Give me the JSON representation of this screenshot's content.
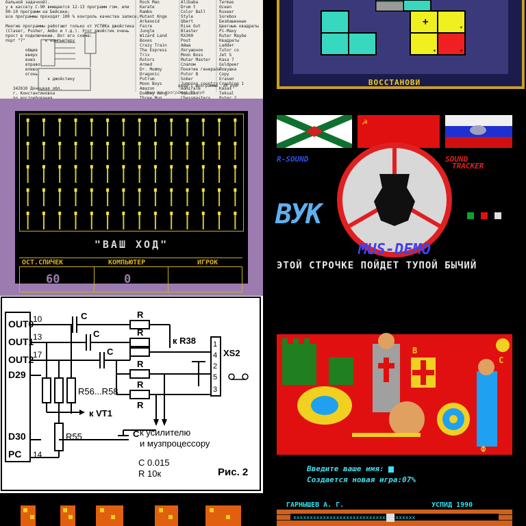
{
  "doc": {
    "col1": "бальной задачкой).\nу в кассету С-90 вмещается 12-13 программ гом. или\n90-10 программ на Бейсике;\nвсе программы проходят 100 % контроль качества записи;\n\nМногие программы работают только от УСТИКа джойстика\n(Сlaser, Pusher, Ambo и т.д.). Этот джойстик очень\nпрост в подключении. Вот его схема:\nпорт \"7\"        к компьютеру\n\n        общие\n        вверх\n        вниз\n        вправо\n        влево\n        огонь\n                 к джойстику\n\n   342810 Донецкая обл.\n   г. Константиновка\n   до востребования\n   Ганебаку А. Е.\n\n        Sound and 6",
    "col2": "Rock Man\nKarate\nRambo\nMutant Knge\nArkanoid\nFaire\nJungle\nWizard Land\nBoxes\nCrazy Train\nThe Express\nTrix\nRotors\nArmed\nDr. Mummy\nDragonic\nPutrum\nMoon Boys\nAmazon\nDonkey Kong\nThree Mug\nTank",
    "col3": "Alibaba\nDrum t\nColor Ball\nStyle\nQbert\nRise Out\nBlaster\nRX300\nPoot\nAйша\nЛягушонок\nMoon Boss\nMutar Master\nСлалом\nПонятие генерала\nPutor B\nSoker\nJumping country\nAdmirale\nSokoban\nChessmasters\nTurbosoun",
    "col4": "Termas\nOcean\nRuxeer\nSorebox\nБезбашенные\nЦветные квадраты\nPi-Maxy\nRuter Maybe\nКвадраты\nLadder\nTutor co\nJet S\nKasa 7\nGoldpeer\nЛовушка\nCopy\nErasen\nCrashing 1\nKasas\nTeksal\nPuter 2\nTetris 2\nRocker Puzzle",
    "footer": "цена 1 программы  30 руб",
    "sign": "Цена за программу 30 руб"
  },
  "puzzle": {
    "word": "ВОССТАНОВИ",
    "colors": {
      "frame": "#2a2a5a",
      "bg": "#3a3a7a",
      "cyan": "#38d8c0",
      "yellow": "#f0f020",
      "red": "#f02020",
      "border": "#c8a020"
    }
  },
  "matches": {
    "title": "\"ВАШ  ХОД\"",
    "headers": [
      "ОСТ.СПИЧЕК",
      "КОМПЬЮТЕР",
      "ИГРОК"
    ],
    "values": [
      "60",
      "0",
      ""
    ],
    "rows": 5,
    "cols": 14
  },
  "mus": {
    "left_label": "R-SOUND",
    "right_label_1": "SOUND",
    "right_label_2": "TRACKER",
    "logo": "ВУК",
    "title": "MUS-DEMO",
    "ticker": "ЭТОЙ СТРОЧКЕ ПОЙДЕТ ТУПОЙ БЫЧИЙ"
  },
  "circuit": {
    "pins_left": [
      "OUT0",
      "OUT1",
      "OUT2",
      "D29",
      "D30",
      "PC"
    ],
    "pin_numbers": [
      "10",
      "13",
      "17",
      "14"
    ],
    "labels": [
      "C",
      "C",
      "C",
      "R",
      "R",
      "R",
      "R",
      "R",
      "к R38",
      "R56...R58",
      "к VT1",
      "R55",
      "C",
      "к усилителю",
      "и музпроцессору",
      "C 0.015",
      "R 10к",
      "Рис. 2",
      "XS2"
    ],
    "connector": [
      "1",
      "4",
      "2",
      "5",
      "3"
    ]
  },
  "knights": {
    "prompt_label": "Введите ваше имя:",
    "status": "Создается новая игра:07%",
    "letters": [
      "В",
      "С",
      "Ф"
    ]
  },
  "bottom": {
    "right_text_left": "ГАРНЫШЕВ А. Г.",
    "right_text_right": "УСПИД 1990"
  }
}
